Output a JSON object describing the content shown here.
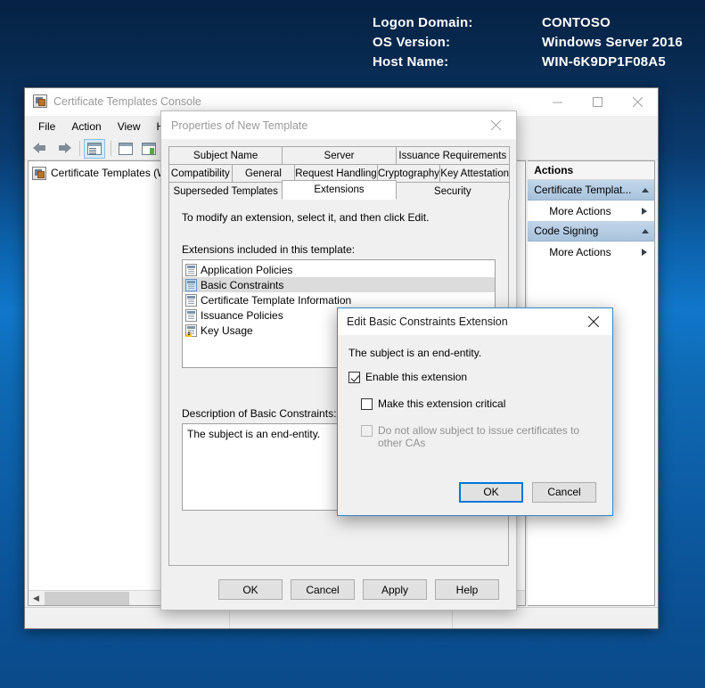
{
  "desktop": {
    "header": [
      {
        "label": "Logon Domain:",
        "value": "CONTOSO"
      },
      {
        "label": "OS Version:",
        "value": "Windows Server 2016"
      },
      {
        "label": "Host Name:",
        "value": "WIN-6K9DP1F08A5"
      }
    ]
  },
  "console": {
    "title": "Certificate Templates Console",
    "icon": "mmc-console-icon",
    "window_buttons": [
      {
        "name": "minimize",
        "glyph": "minimize-icon"
      },
      {
        "name": "maximize",
        "glyph": "maximize-icon"
      },
      {
        "name": "close",
        "glyph": "close-icon"
      }
    ],
    "menus": [
      "File",
      "Action",
      "View",
      "Help"
    ],
    "toolbar": [
      {
        "name": "back-icon"
      },
      {
        "name": "forward-icon"
      },
      {
        "name": "show-hide-console-tree-icon"
      },
      {
        "name": "properties-icon"
      },
      {
        "name": "export-list-icon"
      },
      {
        "name": "help-icon",
        "label": "?"
      }
    ],
    "tree": {
      "items": [
        {
          "label": "Certificate Templates (W",
          "icon": "certificate-templates-icon"
        }
      ]
    },
    "scrollbar": {
      "left_arrow": "chevron-left-icon"
    },
    "actions": {
      "header": "Actions",
      "groups": [
        {
          "label": "Certificate Templat...",
          "caret": "caret-up-icon",
          "items": [
            {
              "label": "More Actions",
              "caret": "caret-right-icon"
            }
          ]
        },
        {
          "label": "Code Signing",
          "caret": "caret-up-icon",
          "items": [
            {
              "label": "More Actions",
              "caret": "caret-right-icon"
            }
          ]
        }
      ]
    }
  },
  "properties_dialog": {
    "title": "Properties of New Template",
    "close": "close-icon",
    "tab_rows": [
      [
        "Subject Name",
        "Server",
        "Issuance Requirements"
      ],
      [
        "Compatibility",
        "General",
        "Request Handling",
        "Cryptography",
        "Key Attestation"
      ],
      [
        "Superseded Templates",
        "Extensions",
        "Security"
      ]
    ],
    "active_tab": "Extensions",
    "instruction": "To modify an extension, select it, and then click Edit.",
    "list_label": "Extensions included in this template:",
    "extensions": [
      {
        "label": "Application Policies",
        "icon": "extension-icon",
        "selected": false
      },
      {
        "label": "Basic Constraints",
        "icon": "extension-icon",
        "selected": true
      },
      {
        "label": "Certificate Template Information",
        "icon": "extension-icon",
        "selected": false
      },
      {
        "label": "Issuance Policies",
        "icon": "extension-icon",
        "selected": false
      },
      {
        "label": "Key Usage",
        "icon": "extension-warning-icon",
        "selected": false
      }
    ],
    "description_label": "Description of Basic Constraints:",
    "description_text": "The subject is an end-entity.",
    "buttons": [
      {
        "label": "OK",
        "default": false
      },
      {
        "label": "Cancel",
        "default": false
      },
      {
        "label": "Apply",
        "default": false
      },
      {
        "label": "Help",
        "default": false
      }
    ]
  },
  "edit_dialog": {
    "title": "Edit Basic Constraints Extension",
    "close": "close-icon",
    "message": "The subject is an end-entity.",
    "checkboxes": [
      {
        "label": "Enable this extension",
        "checked": true,
        "disabled": false,
        "indent": false
      },
      {
        "label": "Make this extension critical",
        "checked": false,
        "disabled": false,
        "indent": true
      },
      {
        "label": "Do not allow subject to issue certificates to other CAs",
        "checked": false,
        "disabled": true,
        "indent": true
      }
    ],
    "buttons": [
      {
        "label": "OK",
        "default": true
      },
      {
        "label": "Cancel",
        "default": false
      }
    ]
  },
  "colors": {
    "accent": "#0078d7",
    "action_group": "#a9c3dd",
    "selection": "#dcdcdc"
  }
}
